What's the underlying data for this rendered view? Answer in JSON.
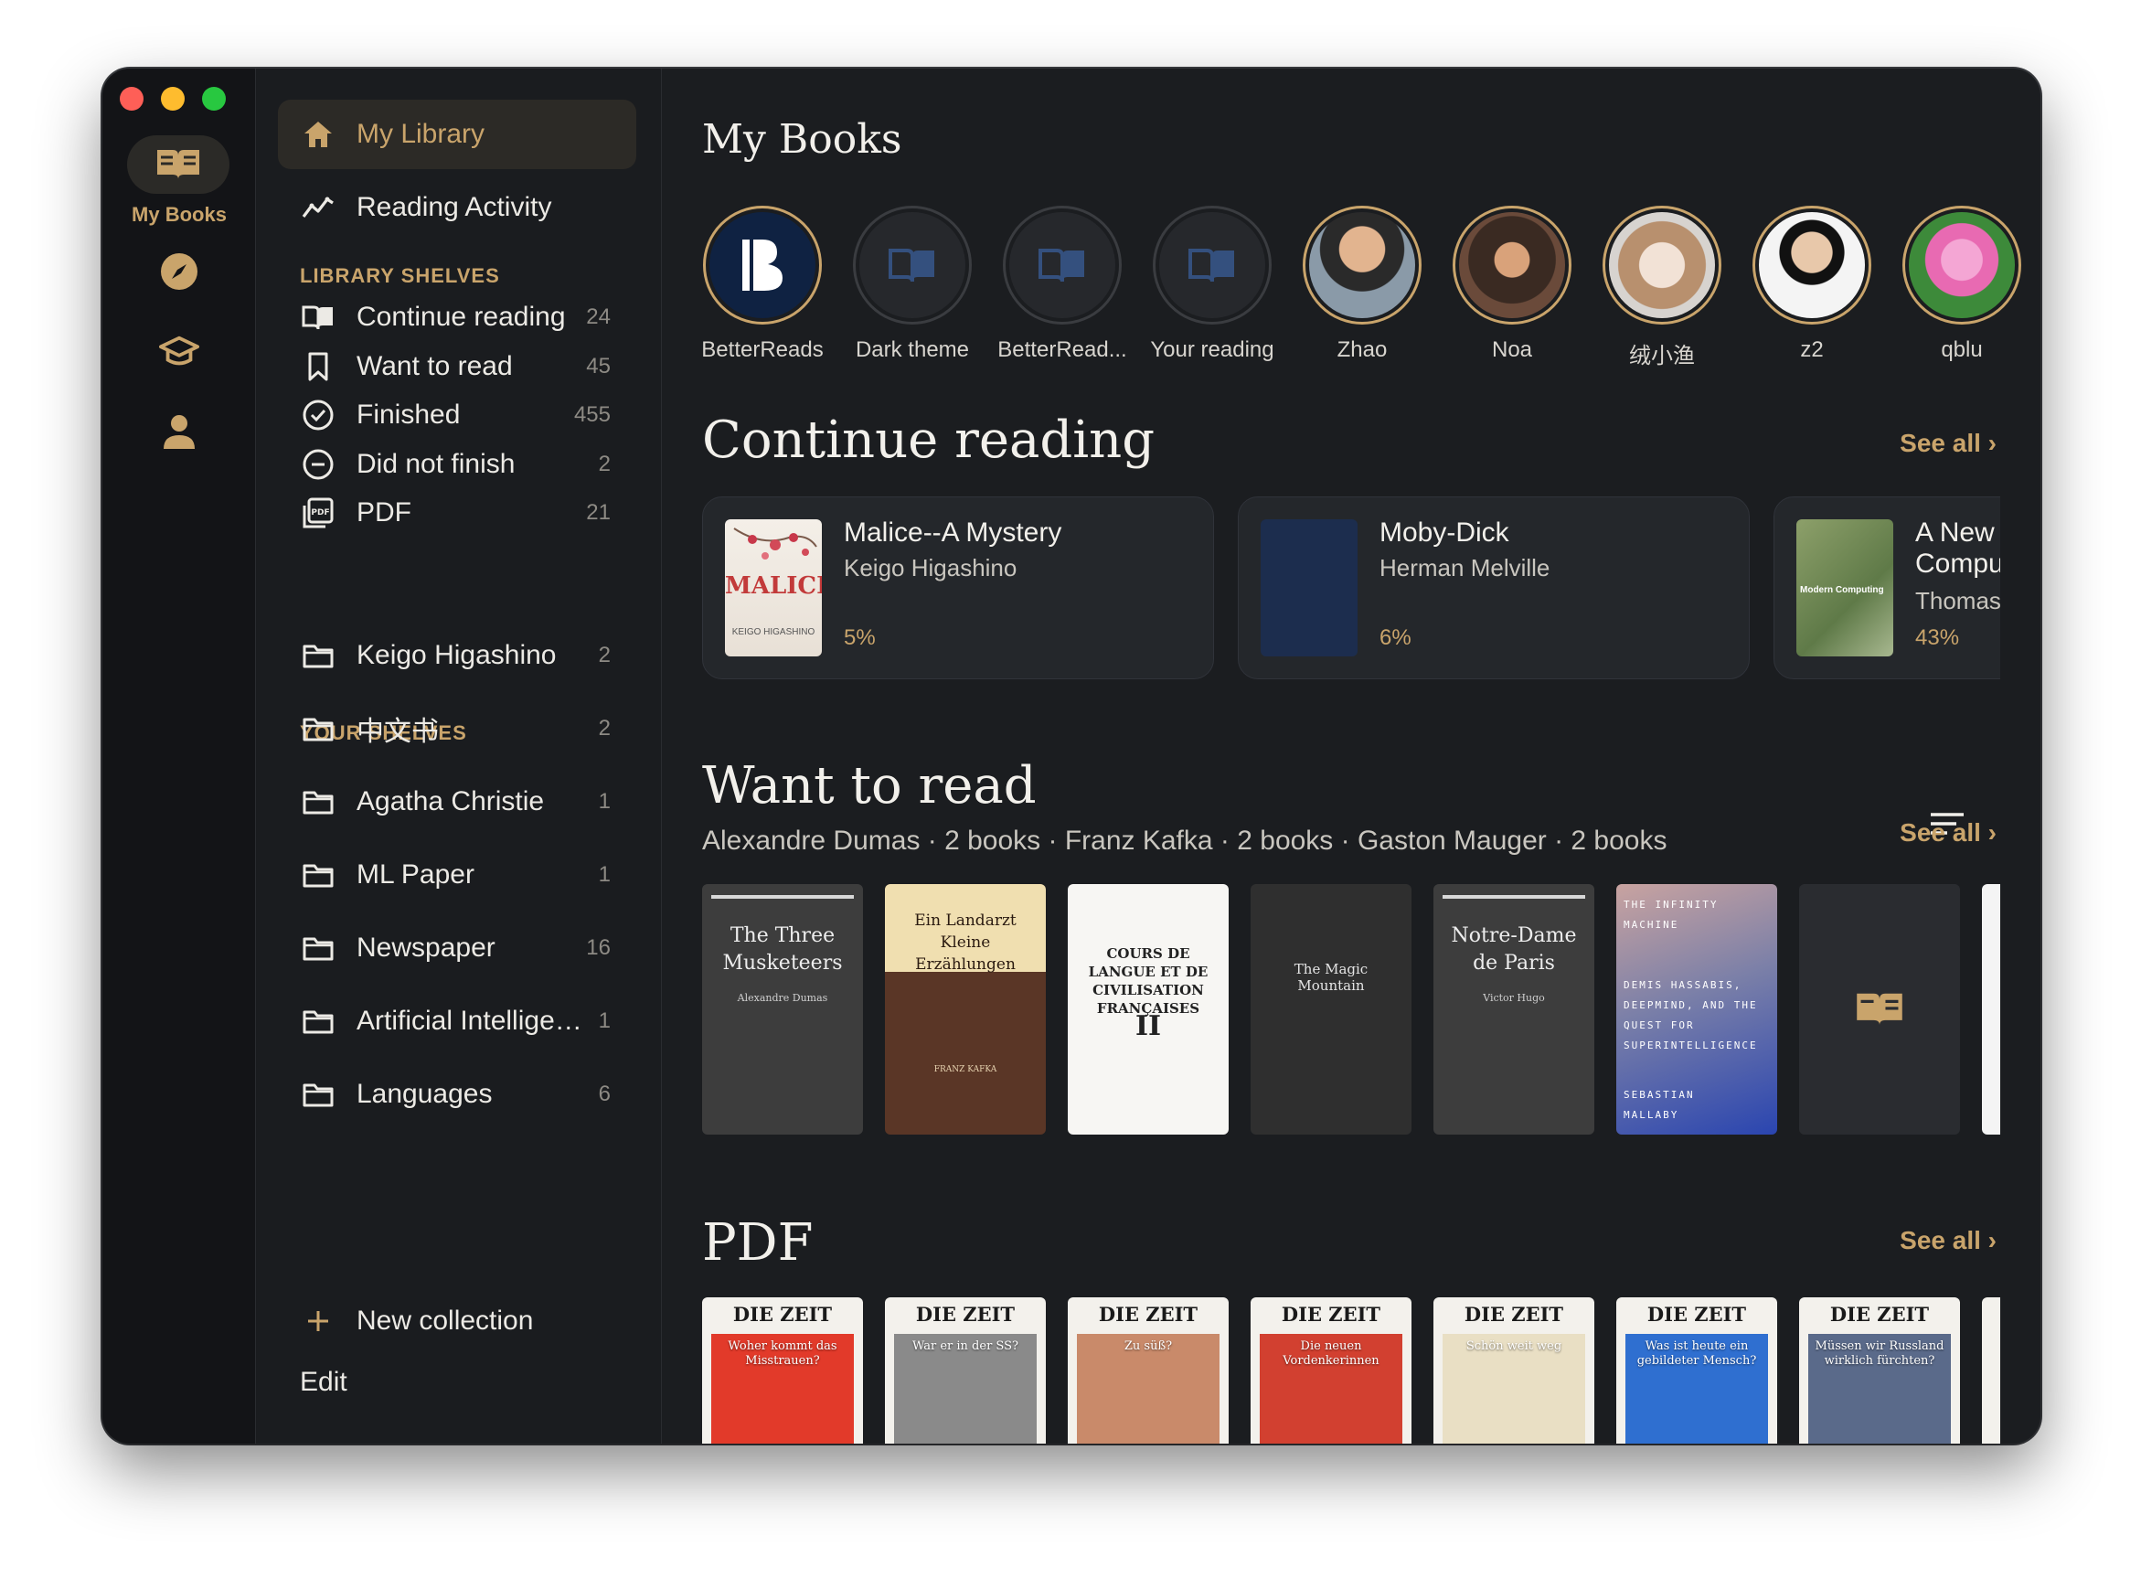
{
  "rail": {
    "active_label": "My Books",
    "icons": [
      "book-icon",
      "compass-icon",
      "graduation-cap-icon",
      "person-icon"
    ]
  },
  "sidebar": {
    "nav": [
      {
        "label": "My Library",
        "icon": "home-icon",
        "active": true
      },
      {
        "label": "Reading Activity",
        "icon": "activity-chart-icon",
        "active": false
      }
    ],
    "library_shelves_header": "LIBRARY SHELVES",
    "library_shelves": [
      {
        "label": "Continue reading",
        "count": "24",
        "icon": "open-book-icon"
      },
      {
        "label": "Want to read",
        "count": "45",
        "icon": "bookmark-icon"
      },
      {
        "label": "Finished",
        "count": "455",
        "icon": "check-circle-icon"
      },
      {
        "label": "Did not finish",
        "count": "2",
        "icon": "minus-circle-icon"
      },
      {
        "label": "PDF",
        "count": "21",
        "icon": "pdf-icon"
      }
    ],
    "your_shelves_header": "YOUR SHELVES",
    "your_shelves": [
      {
        "label": "Keigo Higashino",
        "count": "2"
      },
      {
        "label": "中文书",
        "count": "2"
      },
      {
        "label": "Agatha Christie",
        "count": "1"
      },
      {
        "label": "ML Paper",
        "count": "1"
      },
      {
        "label": "Newspaper",
        "count": "16"
      },
      {
        "label": "Artificial Intelligen...",
        "count": "1"
      },
      {
        "label": "Languages",
        "count": "6"
      }
    ],
    "new_collection": "New collection",
    "edit": "Edit"
  },
  "main": {
    "title": "My Books",
    "add_icon": "plus-icon",
    "avatars": [
      {
        "name": "BetterReads",
        "kind": "logo"
      },
      {
        "name": "Dark theme",
        "kind": "book"
      },
      {
        "name": "BetterRead...",
        "kind": "book"
      },
      {
        "name": "Your reading",
        "kind": "book"
      },
      {
        "name": "Zhao",
        "kind": "photo"
      },
      {
        "name": "Noa",
        "kind": "photo"
      },
      {
        "name": "绒小渔",
        "kind": "photo"
      },
      {
        "name": "z2",
        "kind": "photo"
      },
      {
        "name": "qblu",
        "kind": "photo"
      }
    ],
    "continue_reading": {
      "title": "Continue reading",
      "see_all": "See all ›",
      "items": [
        {
          "title": "Malice--A Mystery",
          "author": "Keigo Higashino",
          "progress": "5%",
          "cover_text": "MALICE",
          "cover_author": "KEIGO HIGASHINO"
        },
        {
          "title": "Moby-Dick",
          "author": "Herman Melville",
          "progress": "6%"
        },
        {
          "title": "A New Compu",
          "author": "Thomas",
          "progress": "43%",
          "cover_text": "Modern Computing"
        }
      ]
    },
    "want_to_read": {
      "title": "Want to read",
      "subtitle": "Alexandre Dumas · 2 books · Franz Kafka · 2 books · Gaston Mauger · 2 books",
      "see_all": "See all ›",
      "covers": [
        {
          "title": "The Three Musketeers",
          "author": "Alexandre Dumas"
        },
        {
          "title": "Ein Landarzt Kleine Erzählungen",
          "author": "FRANZ KAFKA"
        },
        {
          "title": "COURS DE LANGUE ET DE CIVILISATION FRANÇAISES",
          "volume": "II"
        },
        {
          "title": "The Magic Mountain"
        },
        {
          "title": "Notre-Dame de Paris",
          "author": "Victor Hugo"
        },
        {
          "title": "THE INFINITY MACHINE",
          "subtitle": "DEMIS HASSABIS, DEEPMIND, AND THE QUEST FOR SUPERINTELLIGENCE",
          "author": "SEBASTIAN MALLABY"
        },
        {
          "title": "",
          "placeholder": true
        }
      ]
    },
    "pdf": {
      "title": "PDF",
      "see_all": "See all ›",
      "masthead": "DIE ZEIT",
      "headlines": [
        "Woher kommt das Misstrauen?",
        "War er in der SS?",
        "Zu süß?",
        "Die neuen Vordenkerinnen",
        "Schön weit weg",
        "Was ist heute ein gebildeter Mensch?",
        "Müssen wir Russland wirklich fürchten?"
      ]
    }
  },
  "colors": {
    "accent": "#c9a46b",
    "background": "#1b1d20",
    "card": "#24272b"
  }
}
